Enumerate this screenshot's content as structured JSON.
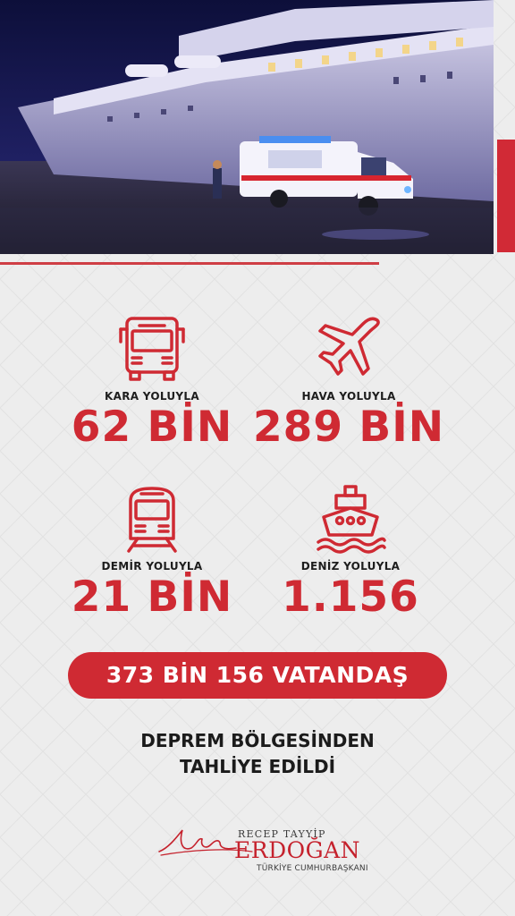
{
  "stats": [
    {
      "id": "kara",
      "label": "KARA YOLUYLA",
      "value": "62 BİN",
      "icon": "bus-icon"
    },
    {
      "id": "hava",
      "label": "HAVA YOLUYLA",
      "value": "289 BİN",
      "icon": "airplane-icon"
    },
    {
      "id": "demir",
      "label": "DEMİR YOLUYLA",
      "value": "21 BİN",
      "icon": "train-icon"
    },
    {
      "id": "deniz",
      "label": "DENİZ YOLUYLA",
      "value": "1.156",
      "icon": "ship-icon"
    }
  ],
  "total": "373 BİN 156 VATANDAŞ",
  "caption": {
    "line1": "DEPREM BÖLGESİNDEN",
    "line2": "TAHLİYE EDİLDİ"
  },
  "signature": {
    "top": "RECEP TAYYİP",
    "name": "ERDOĞAN",
    "subtitle": "TÜRKİYE CUMHURBAŞKANI"
  },
  "colors": {
    "accent": "#cf2a33",
    "background": "#ededed",
    "text": "#1d1d1d"
  }
}
